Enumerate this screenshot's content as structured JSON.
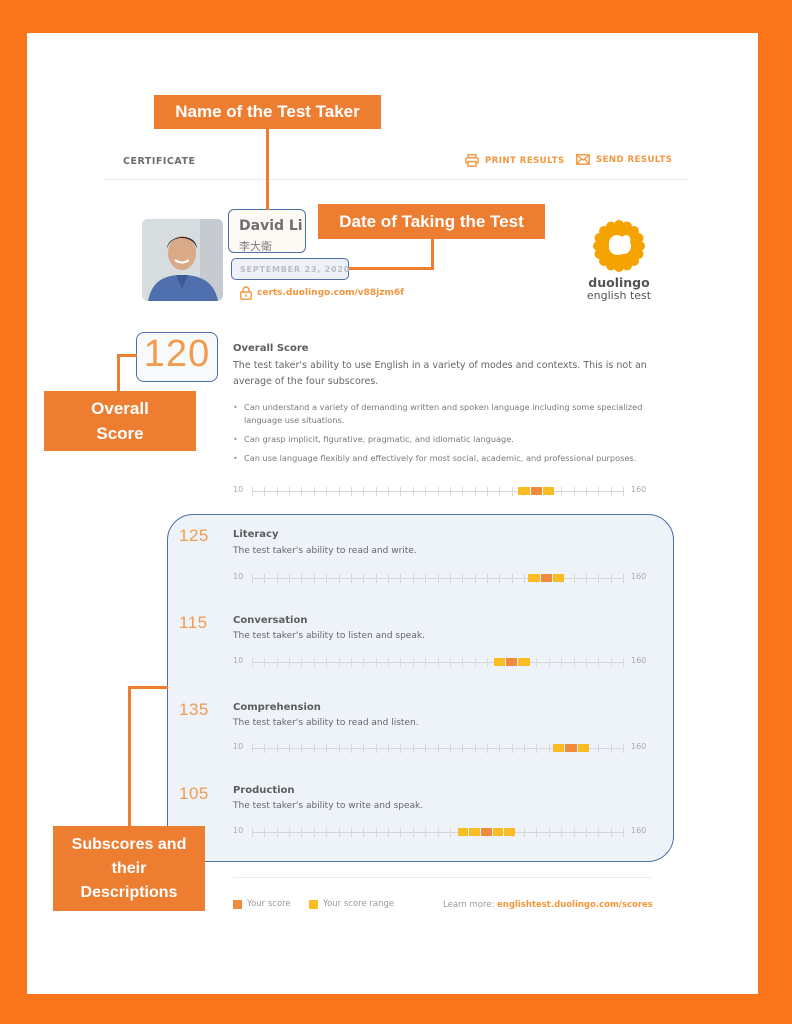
{
  "header": {
    "certificate_label": "CERTIFICATE",
    "actions": [
      {
        "label": "PRINT RESULTS",
        "icon": "printer-icon"
      },
      {
        "label": "SEND RESULTS",
        "icon": "envelope-icon"
      }
    ]
  },
  "test_taker": {
    "name": "David Li",
    "name_native": "李大衛",
    "date": "SEPTEMBER 23, 2020",
    "cert_link": "certs.duolingo.com/v88jzm6f",
    "link_icon": "lock-icon"
  },
  "logo": {
    "line1": "duolingo",
    "line2": "english test",
    "color": "#f5a300"
  },
  "overall": {
    "score": "120",
    "title": "Overall Score",
    "description": "The test taker's ability to use English in a variety of modes and contexts. This is not an average of the four subscores.",
    "bullets": [
      "Can understand a variety of demanding written and spoken language including some specialized language use situations.",
      "Can grasp implicit, figurative, pragmatic, and idiomatic language.",
      "Can use language flexibly and effectively for most social, academic, and professional purposes."
    ],
    "scale": {
      "min": 10,
      "max": 160,
      "min_label": "10",
      "max_label": "160",
      "range": [
        117.5,
        132.5
      ],
      "marker": [
        122.5,
        127.5
      ]
    }
  },
  "subscores": [
    {
      "score": "125",
      "title": "Literacy",
      "description": "The test taker's ability to read and write.",
      "scale": {
        "min": 10,
        "max": 160,
        "min_label": "10",
        "max_label": "160",
        "range": [
          121.5,
          136.5
        ],
        "marker": [
          126.5,
          131.5
        ]
      }
    },
    {
      "score": "115",
      "title": "Conversation",
      "description": "The test taker's ability to listen and speak.",
      "scale": {
        "min": 10,
        "max": 160,
        "min_label": "10",
        "max_label": "160",
        "range": [
          107.5,
          122.5
        ],
        "marker": [
          112.5,
          117.5
        ]
      }
    },
    {
      "score": "135",
      "title": "Comprehension",
      "description": "The test taker's ability to read and listen.",
      "scale": {
        "min": 10,
        "max": 160,
        "min_label": "10",
        "max_label": "160",
        "range": [
          131.5,
          146.5
        ],
        "marker": [
          136.5,
          141.5
        ]
      }
    },
    {
      "score": "105",
      "title": "Production",
      "description": "The test taker's ability to write and speak.",
      "scale": {
        "min": 10,
        "max": 160,
        "min_label": "10",
        "max_label": "160",
        "range": [
          93,
          116.5
        ],
        "marker": [
          102.5,
          107.5
        ]
      }
    }
  ],
  "legend": {
    "your_score": "Your score",
    "your_score_color": "#f08a3c",
    "your_range": "Your score range",
    "your_range_color": "#f9bc22",
    "learn_more_prefix": "Learn more:",
    "learn_more_link": "englishtest.duolingo.com/scores"
  },
  "annotations": {
    "name": "Name of the Test Taker",
    "date": "Date of Taking the Test",
    "overall": "Overall Score",
    "subscores": "Subscores and their Descriptions",
    "color": "#ed7d31",
    "border_color": "#fa7419"
  }
}
